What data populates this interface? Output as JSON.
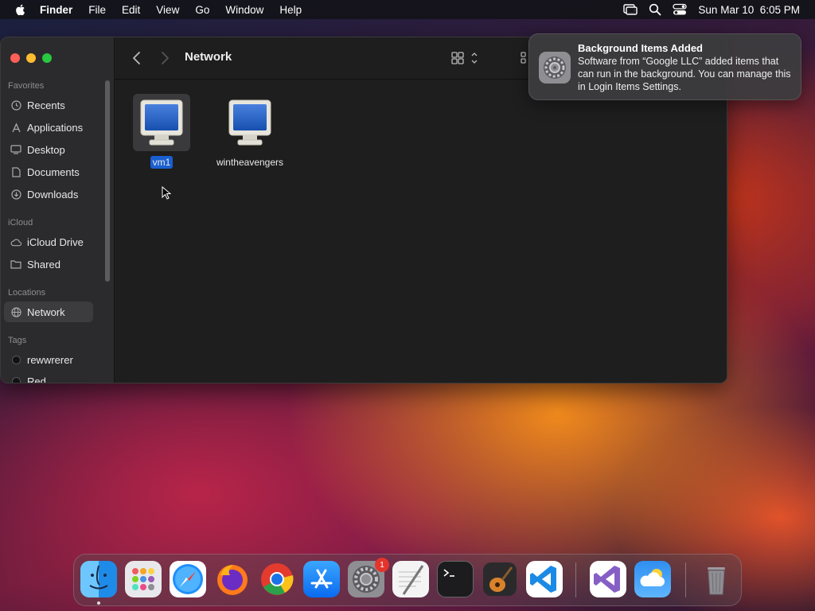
{
  "menubar": {
    "app_name": "Finder",
    "menus": [
      "File",
      "Edit",
      "View",
      "Go",
      "Window",
      "Help"
    ],
    "clock": "Sun Mar 10  6:05 PM"
  },
  "finder": {
    "title": "Network",
    "sidebar": {
      "favorites_header": "Favorites",
      "favorites": [
        "Recents",
        "Applications",
        "Desktop",
        "Documents",
        "Downloads"
      ],
      "icloud_header": "iCloud",
      "icloud": [
        "iCloud Drive",
        "Shared"
      ],
      "locations_header": "Locations",
      "locations": [
        "Network"
      ],
      "tags_header": "Tags",
      "tags": [
        "rewwrerer",
        "Red"
      ]
    },
    "items": [
      {
        "name": "vm1",
        "selected": true
      },
      {
        "name": "wintheavengers",
        "selected": false
      }
    ]
  },
  "notification": {
    "title": "Background Items Added",
    "body": "Software from “Google LLC” added items that can run in the background. You can manage this in Login Items Settings."
  },
  "dock": {
    "apps": [
      "Finder",
      "Launchpad",
      "Safari",
      "Firefox",
      "Google Chrome",
      "App Store",
      "System Settings",
      "TextEdit",
      "Terminal",
      "GarageBand",
      "Visual Studio Code",
      "Visual Studio",
      "Weather",
      "Trash"
    ],
    "system_settings_badge": "1"
  }
}
